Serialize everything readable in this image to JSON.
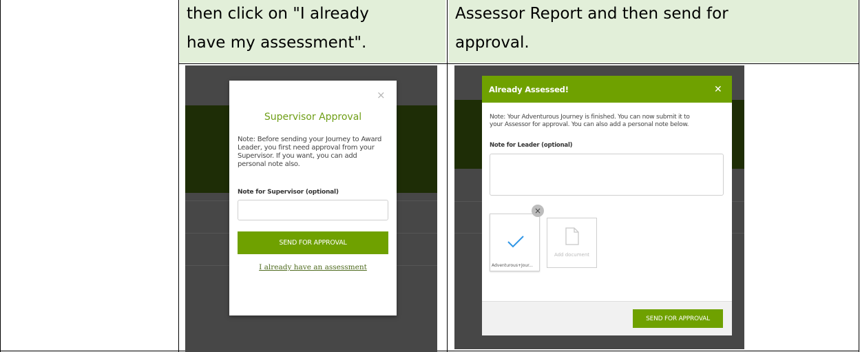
{
  "instructions": {
    "left_text_line1": "then click on \"I already",
    "left_text_line2": "have my assessment\".",
    "right_text_line1": "Assessor Report and then send for",
    "right_text_line2": "approval."
  },
  "supervisor_modal": {
    "close_glyph": "×",
    "title": "Supervisor Approval",
    "note_lines": [
      "Note: Before sending your Journey to Award",
      "Leader, you first need approval from your",
      "Supervisor. If you want, you can add",
      "personal note also."
    ],
    "field_label": "Note for Supervisor (optional)",
    "field_value": "",
    "send_button": "SEND FOR APPROVAL",
    "assessment_link": "I already have an assessment"
  },
  "assessed_modal": {
    "title": "Already Assessed!",
    "close_glyph": "✕",
    "note_lines": [
      "Note: Your Adventurous Journey is finished. You can now submit it to",
      "your Assessor for approval. You can also add a personal note below."
    ],
    "field_label": "Note for Leader (optional)",
    "field_value": "",
    "uploaded_file": {
      "name": "Adventurous+Jour...",
      "status_icon": "checkmark-icon",
      "remove_glyph": "×"
    },
    "add_document_label": "Add document",
    "send_button": "SEND FOR APPROVAL"
  },
  "colors": {
    "header_bg": "#e2efd9",
    "brand_green": "#6fa100",
    "title_green": "#6e9e16",
    "check_blue": "#2f96e6",
    "overlay": "#474747",
    "dark_band": "#1e2d06"
  }
}
